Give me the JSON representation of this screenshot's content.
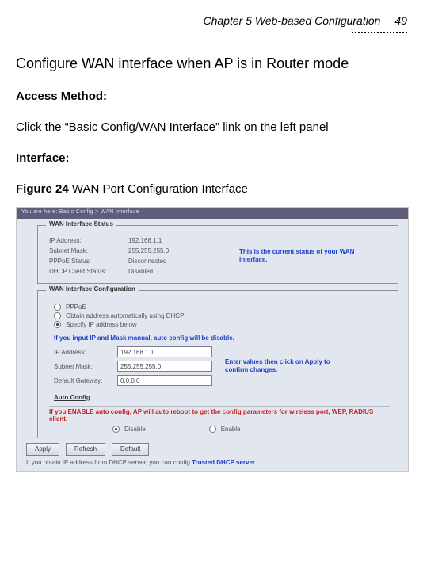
{
  "header": {
    "chapter": "Chapter 5 Web-based Configuration",
    "page": "49"
  },
  "intro": "Configure WAN interface when AP is in Router mode",
  "access_method_label": "Access Method:",
  "access_method_text": "Click the “Basic Config/WAN Interface” link on the left panel",
  "interface_label": "Interface:",
  "figure": {
    "label": "Figure 24",
    "caption": " WAN Port Configuration Interface"
  },
  "shot": {
    "breadcrumb": "You are here: Basic Config > WAN Interface",
    "status_legend": "WAN Interface Status",
    "status": {
      "r1k": "IP Address:",
      "r1v": "192.168.1.1",
      "r2k": "Subnet Mask:",
      "r2v": "255.255.255.0",
      "r3k": "PPPoE Status:",
      "r3v": "Disconnected",
      "r4k": "DHCP Client Status:",
      "r4v": "Disabled",
      "note": "This is the current status of your WAN interface."
    },
    "cfg_legend": "WAN Interface Configuration",
    "radios": {
      "r1": "PPPoE",
      "r2": "Obtain address automatically using DHCP",
      "r3": "Specify IP address below"
    },
    "cfg_note": "If you input IP and Mask manual, auto config will be disable.",
    "inputs": {
      "ipk": "IP Address:",
      "ipv": "192.168.1.1",
      "smk": "Subnet Mask:",
      "smv": "255.255.255.0",
      "gwk": "Default Gateway:",
      "gwv": "0.0.0.0"
    },
    "apply_note": "Enter values then click on Apply to confirm changes.",
    "auto_label": "Auto Config",
    "auto_warn": "If you ENABLE auto config, AP will auto reboot to get the config parameters for wireless port, WEP, RADIUS client.",
    "auto_disable": "Disable",
    "auto_enable": "Enable",
    "buttons": {
      "apply": "Apply",
      "refresh": "Refresh",
      "default": "Default"
    },
    "footnote_a": "If you obtain IP address from DHCP server, you can config ",
    "footnote_b": "Trusted DHCP server"
  }
}
